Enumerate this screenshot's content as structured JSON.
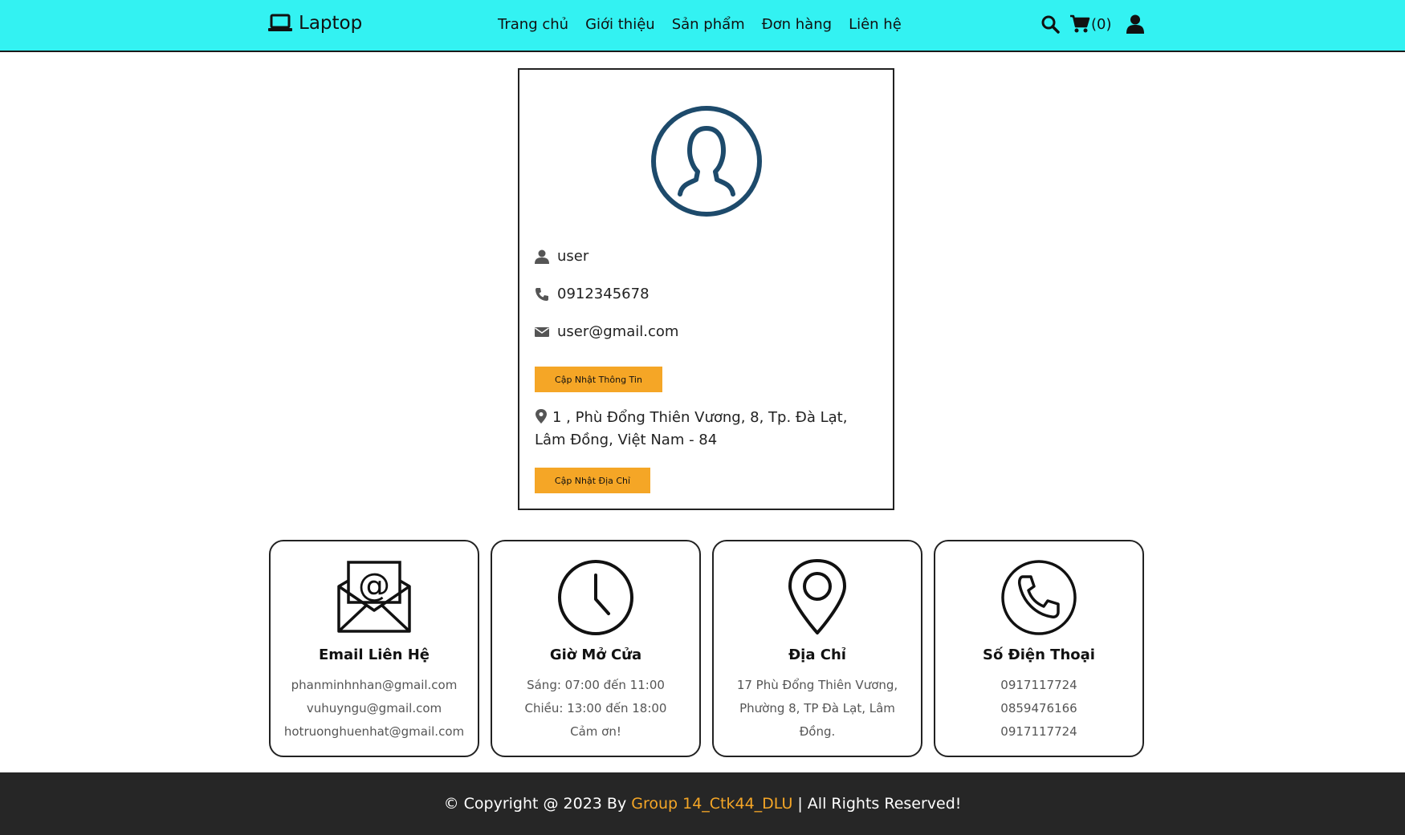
{
  "header": {
    "brand": "Laptop",
    "nav": [
      "Trang chủ",
      "Giới thiệu",
      "Sản phẩm",
      "Đơn hàng",
      "Liên hệ"
    ],
    "cart_count": "(0)"
  },
  "profile": {
    "username": "user",
    "phone": "0912345678",
    "email": "user@gmail.com",
    "update_info_label": "Cập Nhật Thông Tin",
    "address": "1 , Phù Đổng Thiên Vương, 8, Tp. Đà Lạt, Lâm Đồng, Việt Nam - 84",
    "update_address_label": "Cập Nhật Địa Chỉ"
  },
  "contact": {
    "email": {
      "title": "Email Liên Hệ",
      "lines": [
        "phanminhnhan@gmail.com",
        "vuhuyngu@gmail.com",
        "hotruonghuenhat@gmail.com"
      ]
    },
    "hours": {
      "title": "Giờ Mở Cửa",
      "lines": [
        "Sáng: 07:00 đến 11:00",
        "Chiều: 13:00 đến 18:00",
        "Cảm ơn!"
      ]
    },
    "address": {
      "title": "Địa Chỉ",
      "lines": [
        "17 Phù Đổng Thiên Vương,",
        "Phường 8, TP Đà Lạt, Lâm",
        "Đồng."
      ]
    },
    "phone": {
      "title": "Số Điện Thoại",
      "lines": [
        "0917117724",
        "0859476166",
        "0917117724"
      ]
    }
  },
  "footer": {
    "prefix": "© Copyright @ 2023 By",
    "group": "Group 14_Ctk44_DLU",
    "suffix": "| All Rights Reserved!"
  },
  "colors": {
    "header_bg": "#33f2f2",
    "accent": "#f5a626",
    "avatar": "#1d4a6b",
    "footer_bg": "#262626"
  },
  "icons": [
    "laptop-icon",
    "search-icon",
    "cart-icon",
    "user-icon",
    "avatar-icon",
    "phone-icon",
    "envelope-icon",
    "map-marker-icon",
    "mail-open-icon",
    "clock-icon",
    "location-pin-icon",
    "phone-circle-icon"
  ]
}
